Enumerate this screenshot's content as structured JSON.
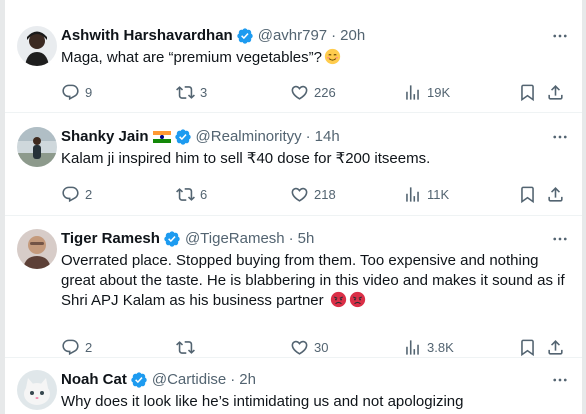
{
  "tweets": [
    {
      "name": "Ashwith Harshavardhan",
      "handle": "@avhr797",
      "separator": "·",
      "time": "20h",
      "text": "Maga, what are “premium vegetables”?",
      "emoji": "smiling-face-with-blush",
      "replies": "9",
      "retweets": "3",
      "likes": "226",
      "views": "19K",
      "verified": true,
      "flag": false
    },
    {
      "name": "Shanky Jain",
      "handle": "@Realminorityy",
      "separator": "·",
      "time": "14h",
      "text": "Kalam ji inspired him to sell ₹40 dose for ₹200 itseems.",
      "replies": "2",
      "retweets": "6",
      "likes": "218",
      "views": "11K",
      "verified": true,
      "flag": true
    },
    {
      "name": "Tiger Ramesh",
      "handle": "@TigeRamesh",
      "separator": "·",
      "time": "5h",
      "text": "Overrated place. Stopped buying from them. Too expensive and nothing great about the taste. He is blabbering in this video and makes it sound as if Shri APJ Kalam as his business partner",
      "emoji": "angry-face",
      "replies": "2",
      "retweets": "",
      "likes": "30",
      "views": "3.8K",
      "verified": true,
      "flag": false
    },
    {
      "name": "Noah Cat",
      "handle": "@Cartidise",
      "separator": "·",
      "time": "2h",
      "text": "Why does it look like he’s intimidating us and not apologizing",
      "verified": true,
      "flag": false
    }
  ],
  "colors": {
    "text": "#0f1419",
    "secondary": "#536471",
    "verified": "#1d9bf0",
    "divider": "#eff3f4"
  }
}
